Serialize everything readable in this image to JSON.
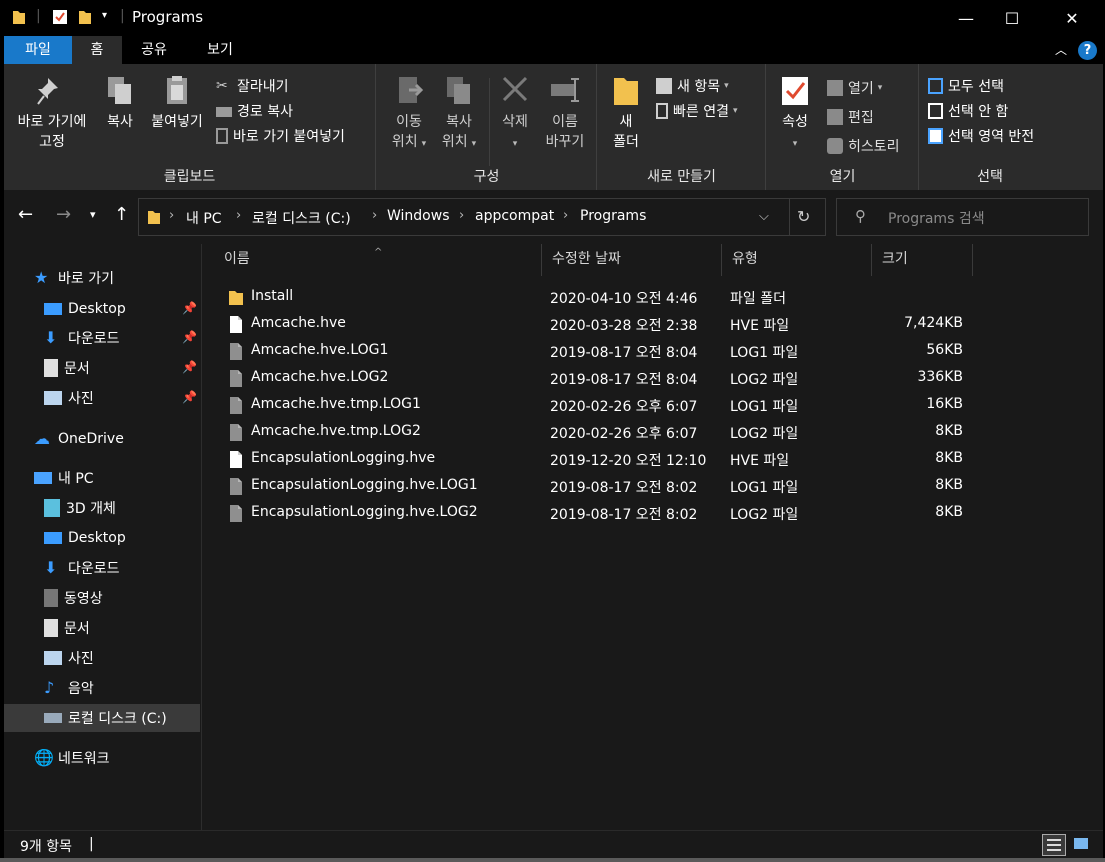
{
  "window": {
    "title": "Programs",
    "controls": {
      "minimize": "—",
      "maximize": "☐",
      "close": "✕"
    }
  },
  "ribbon_tabs": [
    {
      "label": "파일"
    },
    {
      "label": "홈"
    },
    {
      "label": "공유"
    },
    {
      "label": "보기"
    }
  ],
  "ribbon": {
    "clipboard": {
      "label": "클립보드",
      "pin": "바로 가기에\n고정",
      "pin_line1": "바로 가기에",
      "pin_line2": "고정",
      "copy": "복사",
      "paste": "붙여넣기",
      "cut": "잘라내기",
      "copy_path": "경로 복사",
      "paste_shortcut": "바로 가기 붙여넣기"
    },
    "organize": {
      "label": "구성",
      "move_line1": "이동",
      "move_line2": "위치",
      "copyto_line1": "복사",
      "copyto_line2": "위치",
      "delete": "삭제",
      "rename_line1": "이름",
      "rename_line2": "바꾸기"
    },
    "new": {
      "label": "새로 만들기",
      "folder_line1": "새",
      "folder_line2": "폴더",
      "new_item": "새 항목",
      "easy_access": "빠른 연결"
    },
    "open": {
      "label": "열기",
      "properties": "속성",
      "open": "열기",
      "edit": "편집",
      "history": "히스토리"
    },
    "select": {
      "label": "선택",
      "select_all": "모두 선택",
      "select_none": "선택 안 함",
      "invert": "선택 영역 반전"
    }
  },
  "address": {
    "crumbs": [
      "내 PC",
      "로컬 디스크 (C:)",
      "Windows",
      "appcompat",
      "Programs"
    ],
    "search_placeholder": "Programs 검색"
  },
  "nav": {
    "quick_access": "바로 가기",
    "quick_items": [
      "Desktop",
      "다운로드",
      "문서",
      "사진"
    ],
    "onedrive": "OneDrive",
    "this_pc": "내 PC",
    "pc_items": [
      "3D 개체",
      "Desktop",
      "다운로드",
      "동영상",
      "문서",
      "사진",
      "음악",
      "로컬 디스크 (C:)"
    ],
    "network": "네트워크"
  },
  "columns": {
    "name": "이름",
    "date": "수정한 날짜",
    "type": "유형",
    "size": "크기"
  },
  "files": [
    {
      "name": "Install",
      "date": "2020-04-10 오전 4:46",
      "type": "파일 폴더",
      "size": "",
      "icon": "folder-icon"
    },
    {
      "name": "Amcache.hve",
      "date": "2020-03-28 오전 2:38",
      "type": "HVE 파일",
      "size": "7,424KB",
      "icon": "file-icon"
    },
    {
      "name": "Amcache.hve.LOG1",
      "date": "2019-08-17 오전 8:04",
      "type": "LOG1 파일",
      "size": "56KB",
      "icon": "system-file-icon"
    },
    {
      "name": "Amcache.hve.LOG2",
      "date": "2019-08-17 오전 8:04",
      "type": "LOG2 파일",
      "size": "336KB",
      "icon": "system-file-icon"
    },
    {
      "name": "Amcache.hve.tmp.LOG1",
      "date": "2020-02-26 오후 6:07",
      "type": "LOG1 파일",
      "size": "16KB",
      "icon": "system-file-icon"
    },
    {
      "name": "Amcache.hve.tmp.LOG2",
      "date": "2020-02-26 오후 6:07",
      "type": "LOG2 파일",
      "size": "8KB",
      "icon": "system-file-icon"
    },
    {
      "name": "EncapsulationLogging.hve",
      "date": "2019-12-20 오전 12:10",
      "type": "HVE 파일",
      "size": "8KB",
      "icon": "file-icon"
    },
    {
      "name": "EncapsulationLogging.hve.LOG1",
      "date": "2019-08-17 오전 8:02",
      "type": "LOG1 파일",
      "size": "8KB",
      "icon": "system-file-icon"
    },
    {
      "name": "EncapsulationLogging.hve.LOG2",
      "date": "2019-08-17 오전 8:02",
      "type": "LOG2 파일",
      "size": "8KB",
      "icon": "system-file-icon"
    }
  ],
  "status": {
    "item_count": "9개 항목",
    "divider": "|"
  },
  "colors": {
    "accent": "#1979ca",
    "folder": "#f2c14e",
    "background": "#191919",
    "ribbon": "#2b2b2b"
  }
}
